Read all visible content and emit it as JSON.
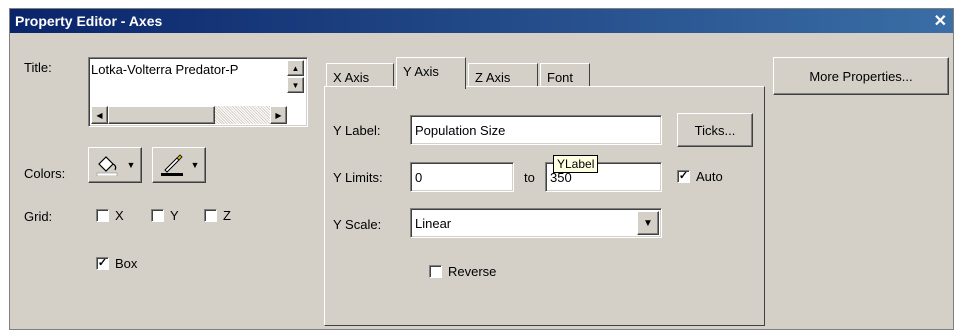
{
  "window": {
    "title": "Property Editor - Axes",
    "close_glyph": "✕"
  },
  "left": {
    "title_label": "Title:",
    "title_value": "Lotka-Volterra Predator-P",
    "colors_label": "Colors:",
    "grid_label": "Grid:",
    "grid": {
      "x": "X",
      "y": "Y",
      "z": "Z"
    },
    "box_label": "Box",
    "box_checked": "✓"
  },
  "tabs": [
    {
      "label": "X Axis"
    },
    {
      "label": "Y Axis"
    },
    {
      "label": "Z Axis"
    },
    {
      "label": "Font"
    }
  ],
  "yaxis": {
    "label_label": "Y Label:",
    "label_value": "Population Size",
    "ticks_button": "Ticks...",
    "limits_label": "Y Limits:",
    "limit_min": "0",
    "to_label": "to",
    "limit_max": "350",
    "auto_label": "Auto",
    "auto_checked": "✓",
    "scale_label": "Y Scale:",
    "scale_value": "Linear",
    "reverse_label": "Reverse",
    "tooltip": "YLabel"
  },
  "right": {
    "more_button": "More Properties..."
  },
  "icons": {
    "fill": "paint-bucket-icon",
    "edge": "pen-color-icon",
    "dropdown": "dropdown-arrow-icon"
  }
}
